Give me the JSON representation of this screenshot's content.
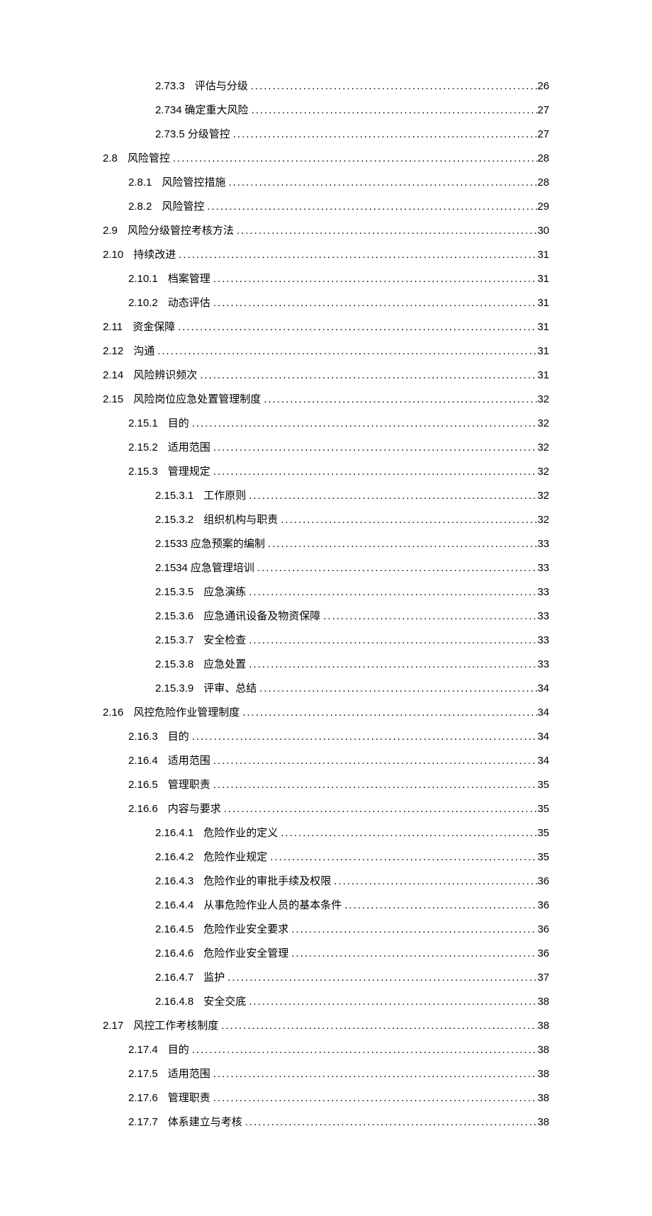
{
  "toc": [
    {
      "level": 3,
      "num": "2.73.3",
      "title": "评估与分级",
      "page": "26"
    },
    {
      "level": 3,
      "num": "2.734",
      "title": "确定重大风险",
      "page": "27",
      "tight": true
    },
    {
      "level": 3,
      "num": "2.73.5",
      "title": "分级管控",
      "page": "27",
      "tight": true
    },
    {
      "level": 1,
      "num": "2.8",
      "title": "风险管控",
      "page": "28"
    },
    {
      "level": 2,
      "num": "2.8.1",
      "title": "风险管控措施",
      "page": "28"
    },
    {
      "level": 2,
      "num": "2.8.2",
      "title": "风险管控",
      "page": "29"
    },
    {
      "level": 1,
      "num": "2.9",
      "title": "风险分级管控考核方法",
      "page": "30"
    },
    {
      "level": 1,
      "num": "2.10",
      "title": "持续改进",
      "page": "31"
    },
    {
      "level": 2,
      "num": "2.10.1",
      "title": "档案管理",
      "page": "31"
    },
    {
      "level": 2,
      "num": "2.10.2",
      "title": "动态评估",
      "page": "31"
    },
    {
      "level": 1,
      "num": "2.11",
      "title": "资金保障",
      "page": "31"
    },
    {
      "level": 1,
      "num": "2.12",
      "title": "沟通",
      "page": "31"
    },
    {
      "level": 1,
      "num": "2.14",
      "title": "风险辨识频次",
      "page": "31"
    },
    {
      "level": 1,
      "num": "2.15",
      "title": "风险岗位应急处置管理制度",
      "page": "32"
    },
    {
      "level": 2,
      "num": "2.15.1",
      "title": "目的",
      "page": "32"
    },
    {
      "level": 2,
      "num": "2.15.2",
      "title": "适用范围",
      "page": "32"
    },
    {
      "level": 2,
      "num": "2.15.3",
      "title": "管理规定",
      "page": "32"
    },
    {
      "level": 3,
      "num": "2.15.3.1",
      "title": "工作原则",
      "page": "32"
    },
    {
      "level": 3,
      "num": "2.15.3.2",
      "title": "组织机构与职责",
      "page": "32"
    },
    {
      "level": 3,
      "num": "2.1533",
      "title": "应急预案的编制",
      "page": "33",
      "tight": true
    },
    {
      "level": 3,
      "num": "2.1534",
      "title": "应急管理培训",
      "page": "33",
      "tight": true
    },
    {
      "level": 3,
      "num": "2.15.3.5",
      "title": "应急演练",
      "page": "33"
    },
    {
      "level": 3,
      "num": "2.15.3.6",
      "title": "应急通讯设备及物资保障",
      "page": "33"
    },
    {
      "level": 3,
      "num": "2.15.3.7",
      "title": "安全检查",
      "page": "33"
    },
    {
      "level": 3,
      "num": "2.15.3.8",
      "title": "应急处置",
      "page": "33"
    },
    {
      "level": 3,
      "num": "2.15.3.9",
      "title": "评审、总结",
      "page": "34"
    },
    {
      "level": 1,
      "num": "2.16",
      "title": "风控危险作业管理制度",
      "page": "34"
    },
    {
      "level": 2,
      "num": "2.16.3",
      "title": "目的",
      "page": "34"
    },
    {
      "level": 2,
      "num": "2.16.4",
      "title": "适用范围",
      "page": "34"
    },
    {
      "level": 2,
      "num": "2.16.5",
      "title": "管理职责",
      "page": "35"
    },
    {
      "level": 2,
      "num": "2.16.6",
      "title": "内容与要求",
      "page": "35"
    },
    {
      "level": 3,
      "num": "2.16.4.1",
      "title": "危险作业的定义",
      "page": "35"
    },
    {
      "level": 3,
      "num": "2.16.4.2",
      "title": "危险作业规定",
      "page": "35"
    },
    {
      "level": 3,
      "num": "2.16.4.3",
      "title": "危险作业的审批手续及权限",
      "page": "36"
    },
    {
      "level": 3,
      "num": "2.16.4.4",
      "title": "从事危险作业人员的基本条件",
      "page": "36"
    },
    {
      "level": 3,
      "num": "2.16.4.5",
      "title": "危险作业安全要求",
      "page": "36"
    },
    {
      "level": 3,
      "num": "2.16.4.6",
      "title": "危险作业安全管理",
      "page": "36"
    },
    {
      "level": 3,
      "num": "2.16.4.7",
      "title": "监护",
      "page": "37"
    },
    {
      "level": 3,
      "num": "2.16.4.8",
      "title": "安全交底",
      "page": "38"
    },
    {
      "level": 1,
      "num": "2.17",
      "title": "风控工作考核制度",
      "page": "38"
    },
    {
      "level": 2,
      "num": "2.17.4",
      "title": "目的",
      "page": "38"
    },
    {
      "level": 2,
      "num": "2.17.5",
      "title": "适用范围",
      "page": "38"
    },
    {
      "level": 2,
      "num": "2.17.6",
      "title": "管理职责",
      "page": "38"
    },
    {
      "level": 2,
      "num": "2.17.7",
      "title": "体系建立与考核",
      "page": "38"
    }
  ]
}
